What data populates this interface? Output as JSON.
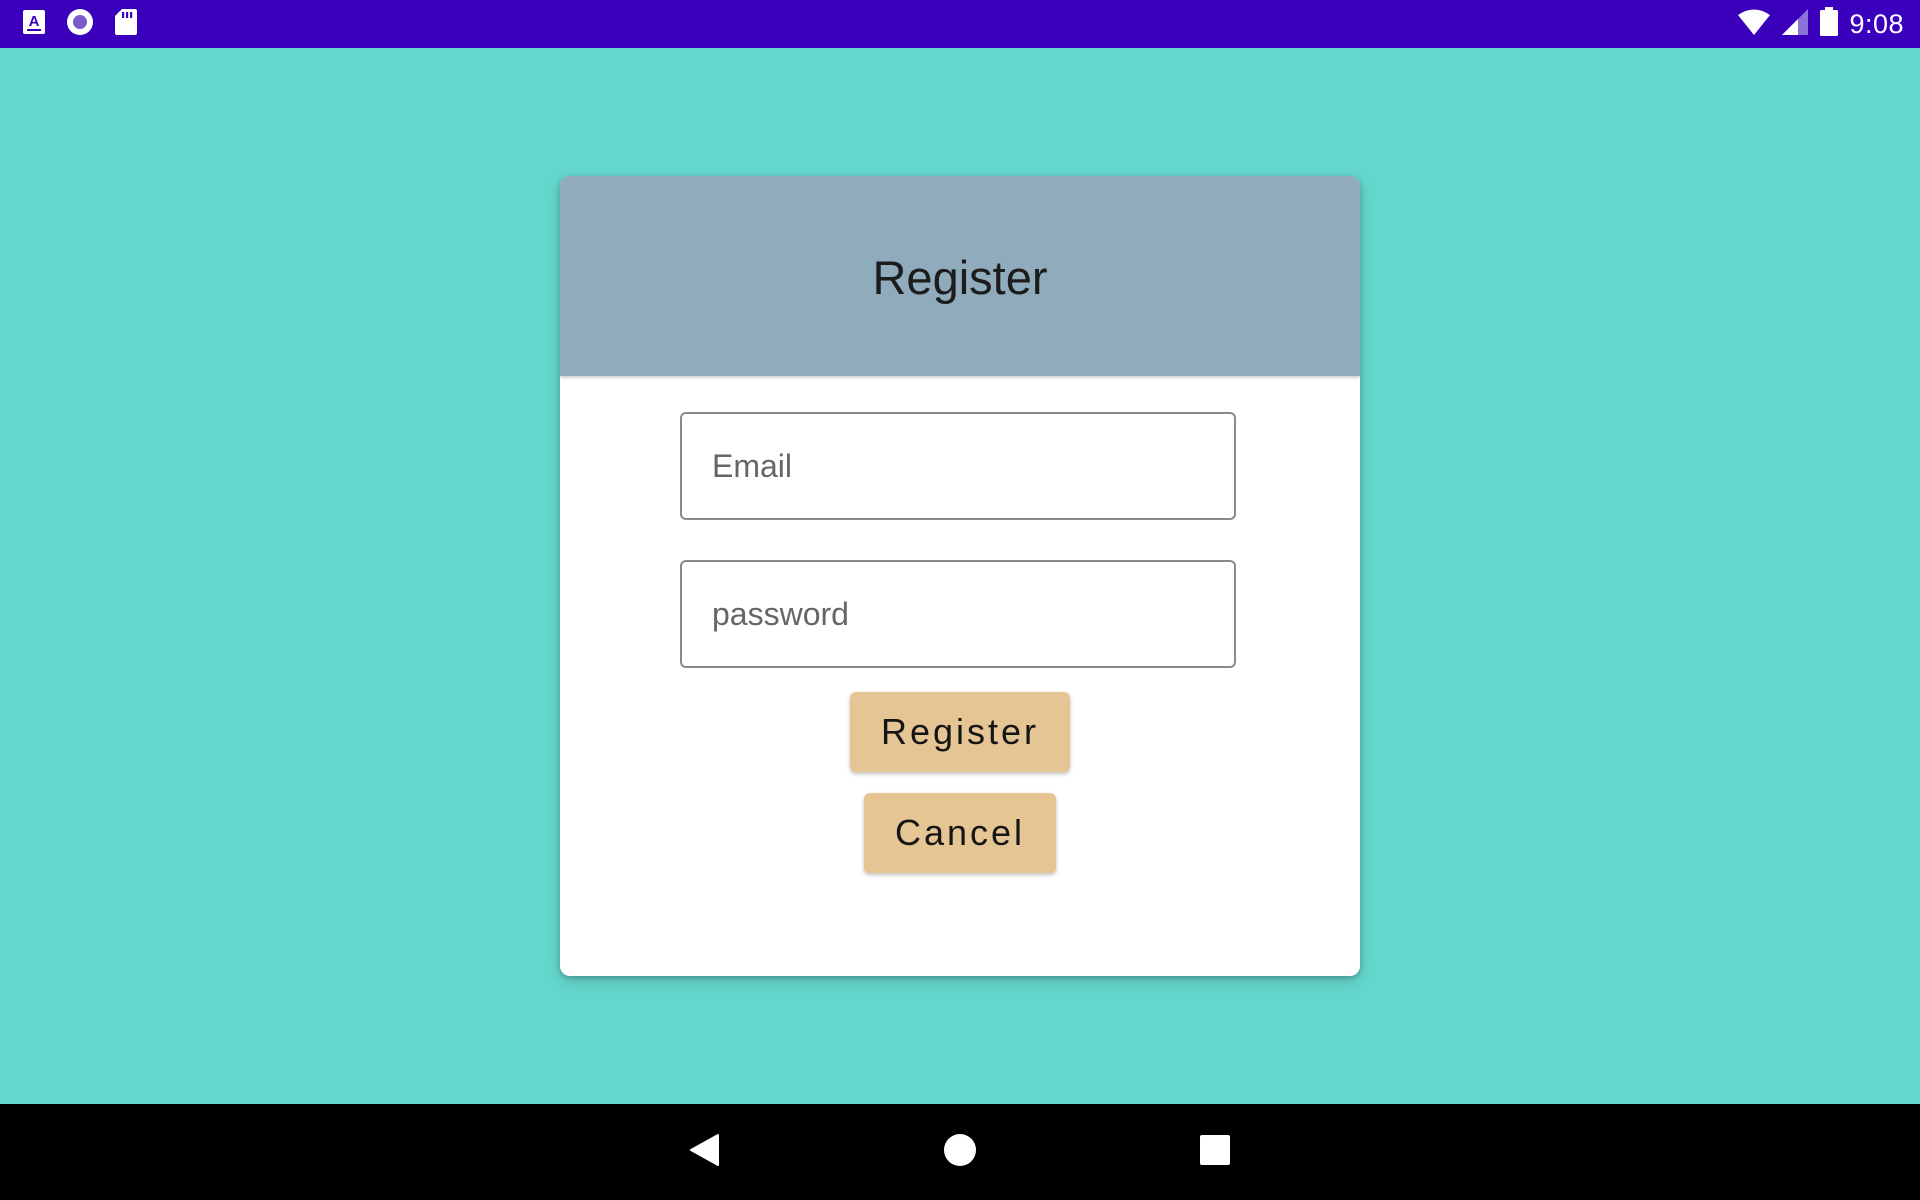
{
  "status_bar": {
    "time": "9:08",
    "left_icons": [
      "a-keyboard-icon",
      "circle-app-icon",
      "sd-card-icon"
    ],
    "right_icons": [
      "wifi-icon",
      "signal-icon",
      "battery-icon"
    ],
    "background": "#3a00bc"
  },
  "screen": {
    "background": "#64d7cc"
  },
  "card": {
    "title": "Register",
    "header_color": "#90abbc",
    "email": {
      "placeholder": "Email",
      "value": ""
    },
    "password": {
      "placeholder": "password",
      "value": ""
    },
    "register_label": "Register",
    "cancel_label": "Cancel",
    "button_color": "#e6c594"
  },
  "nav_bar": {
    "buttons": [
      "back-icon",
      "home-icon",
      "recents-icon"
    ]
  }
}
